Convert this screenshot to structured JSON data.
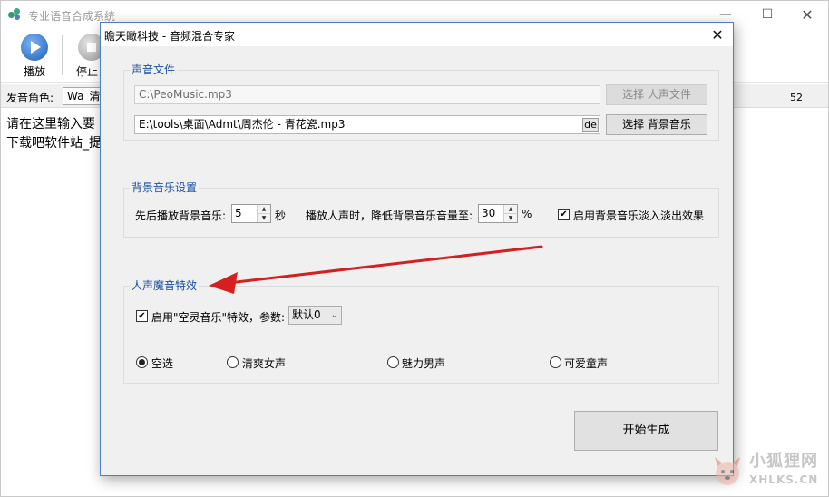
{
  "main_window": {
    "title": "专业语音合成系统",
    "min_icon": "minimize-icon",
    "max_icon": "maximize-icon",
    "close_icon": "close-icon",
    "toolbar": {
      "play_label": "播放",
      "stop_label": "停止"
    },
    "role_label": "发音角色:",
    "role_value": "Wa_清新",
    "role_number": "52",
    "text_content": "请在这里输入要\n下载吧软件站_提"
  },
  "dialog": {
    "title": "瞻天瞰科技 - 音频混合专家",
    "close_glyph": "✕",
    "sound_files": {
      "legend": "声音文件",
      "voice_path": "C:\\PeoMusic.mp3",
      "voice_button": "选择 人声文件",
      "bg_path": "E:\\tools\\桌面\\Admt\\周杰伦 - 青花瓷.mp3",
      "bg_inline_button": "de",
      "bg_button": "选择 背景音乐"
    },
    "bg_settings": {
      "legend": "背景音乐设置",
      "before_label": "先后播放背景音乐:",
      "before_value": "5",
      "before_unit": "秒",
      "reduce_label": "播放人声时，降低背景音乐音量至:",
      "reduce_value": "30",
      "reduce_unit": "%",
      "fade_checked": true,
      "fade_label": "启用背景音乐淡入淡出效果"
    },
    "voice_effects": {
      "legend": "人声魔音特效",
      "enable_checked": true,
      "enable_label": "启用\"空灵音乐\"特效，参数:",
      "param_value": "默认0",
      "options": [
        {
          "label": "空选",
          "checked": true
        },
        {
          "label": "清爽女声",
          "checked": false
        },
        {
          "label": "魅力男声",
          "checked": false
        },
        {
          "label": "可爱童声",
          "checked": false
        }
      ]
    },
    "generate_button": "开始生成"
  },
  "annotation": {
    "arrow_color": "#d42020"
  },
  "watermark": {
    "line1": "小狐狸网",
    "line2": "XHLKS.CN"
  },
  "colors": {
    "legend_blue": "#1a4fa3",
    "play_blue": "#2f6fc4",
    "stop_gray": "#b8b8b8"
  }
}
